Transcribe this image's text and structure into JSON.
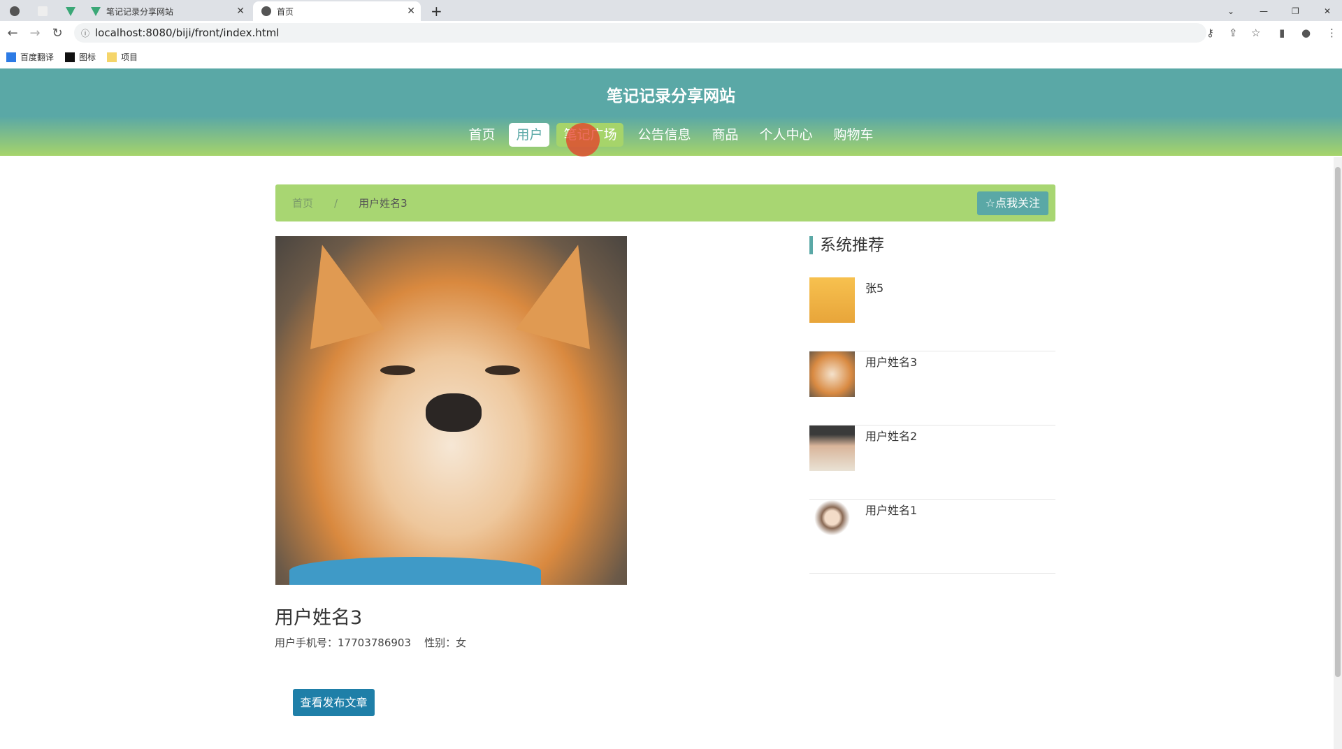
{
  "browser": {
    "tabs": [
      {
        "title": "笔记记录分享网站"
      },
      {
        "title": "首页"
      }
    ],
    "url": "localhost:8080/biji/front/index.html",
    "bookmarks": [
      "百度翻译",
      "图标",
      "项目"
    ]
  },
  "header": {
    "title": "笔记记录分享网站",
    "nav": [
      "首页",
      "用户",
      "笔记广场",
      "公告信息",
      "商品",
      "个人中心",
      "购物车"
    ],
    "active": "用户",
    "colors": {
      "primary": "#5aa8a6",
      "accent": "#a6d46a"
    }
  },
  "breadcrumb": {
    "home": "首页",
    "sep": "/",
    "current": "用户姓名3",
    "follow": "☆点我关注"
  },
  "profile": {
    "name": "用户姓名3",
    "phone_label": "用户手机号：",
    "phone": "17703786903",
    "gender_label": "性别：",
    "gender": "女",
    "posts_button": "查看发布文章"
  },
  "sidebar": {
    "title": "系统推荐",
    "items": [
      {
        "name": "张5"
      },
      {
        "name": "用户姓名3"
      },
      {
        "name": "用户姓名2"
      },
      {
        "name": "用户姓名1"
      }
    ]
  }
}
